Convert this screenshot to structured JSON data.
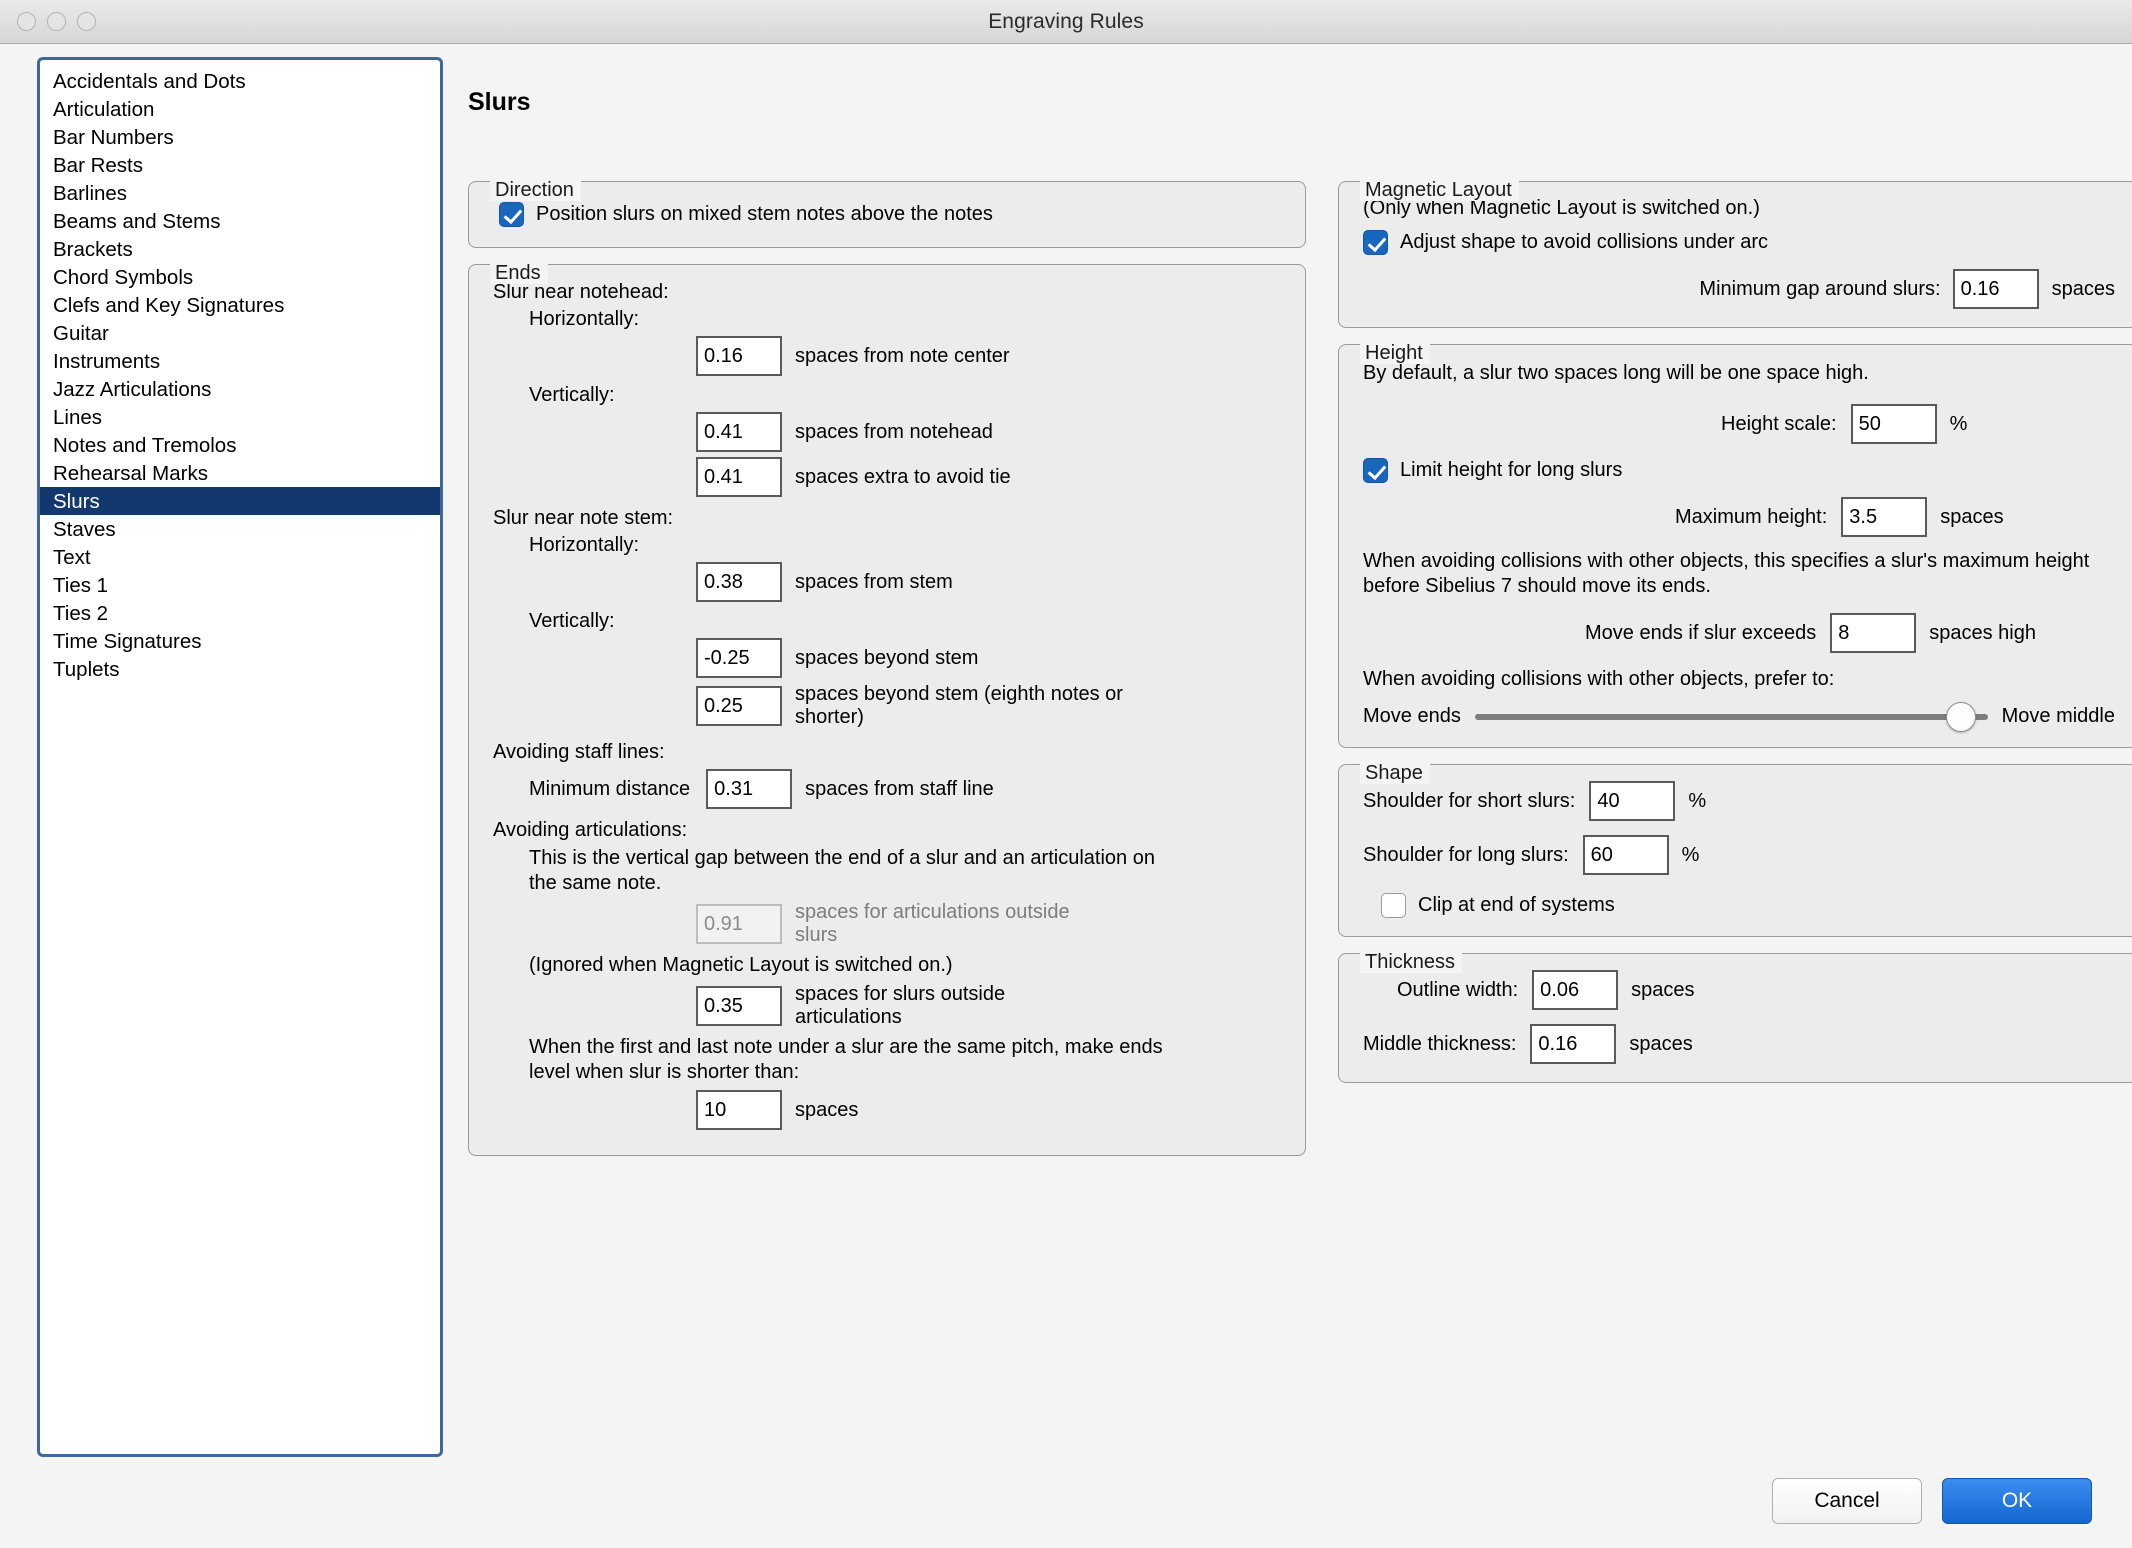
{
  "window": {
    "title": "Engraving Rules",
    "traffic_lights": [
      "close-button",
      "minimize-button",
      "zoom-button"
    ]
  },
  "sidebar": {
    "items": [
      {
        "label": "Accidentals and Dots",
        "selected": false
      },
      {
        "label": "Articulation",
        "selected": false
      },
      {
        "label": "Bar Numbers",
        "selected": false
      },
      {
        "label": "Bar Rests",
        "selected": false
      },
      {
        "label": "Barlines",
        "selected": false
      },
      {
        "label": "Beams and Stems",
        "selected": false
      },
      {
        "label": "Brackets",
        "selected": false
      },
      {
        "label": "Chord Symbols",
        "selected": false
      },
      {
        "label": "Clefs and Key Signatures",
        "selected": false
      },
      {
        "label": "Guitar",
        "selected": false
      },
      {
        "label": "Instruments",
        "selected": false
      },
      {
        "label": "Jazz Articulations",
        "selected": false
      },
      {
        "label": "Lines",
        "selected": false
      },
      {
        "label": "Notes and Tremolos",
        "selected": false
      },
      {
        "label": "Rehearsal Marks",
        "selected": false
      },
      {
        "label": "Slurs",
        "selected": true
      },
      {
        "label": "Staves",
        "selected": false
      },
      {
        "label": "Text",
        "selected": false
      },
      {
        "label": "Ties 1",
        "selected": false
      },
      {
        "label": "Ties 2",
        "selected": false
      },
      {
        "label": "Time Signatures",
        "selected": false
      },
      {
        "label": "Tuplets",
        "selected": false
      }
    ]
  },
  "page": {
    "title": "Slurs"
  },
  "direction": {
    "legend": "Direction",
    "checkbox_label": "Position slurs on mixed stem notes above the notes",
    "checked": true
  },
  "ends": {
    "legend": "Ends",
    "near_notehead_heading": "Slur near notehead:",
    "horizontally_label": "Horizontally:",
    "vertically_label": "Vertically:",
    "note_center": {
      "value": "0.16",
      "unit": "spaces from note center"
    },
    "from_notehead": {
      "value": "0.41",
      "unit": "spaces from notehead"
    },
    "extra_avoid_tie": {
      "value": "0.41",
      "unit": "spaces extra to avoid tie"
    },
    "near_stem_heading": "Slur near note stem:",
    "horizontally_label2": "Horizontally:",
    "from_stem": {
      "value": "0.38",
      "unit": "spaces from stem"
    },
    "vertically_label2": "Vertically:",
    "beyond_stem": {
      "value": "-0.25",
      "unit": "spaces beyond stem"
    },
    "beyond_stem_eighth": {
      "value": "0.25",
      "unit": "spaces beyond stem (eighth notes or shorter)"
    },
    "avoiding_staff_lines_heading": "Avoiding staff lines:",
    "minimum_distance_label": "Minimum distance",
    "minimum_distance": {
      "value": "0.31",
      "unit": "spaces from staff line"
    },
    "avoiding_articulations_heading": "Avoiding articulations:",
    "articulation_note": "This is the vertical gap between the end of a slur and an articulation on the same note.",
    "articulations_outside": {
      "value": "0.91",
      "unit": "spaces for articulations outside slurs",
      "disabled": true
    },
    "ignored_note": "(Ignored when Magnetic Layout is switched on.)",
    "slurs_outside": {
      "value": "0.35",
      "unit": "spaces for slurs outside articulations"
    },
    "same_pitch_note": "When the first and last note under a slur are the same pitch, make ends level when slur is shorter than:",
    "shorter_than": {
      "value": "10",
      "unit": "spaces"
    }
  },
  "magnetic_layout": {
    "legend": "Magnetic Layout",
    "note": "(Only when Magnetic Layout is switched on.)",
    "adjust_shape_label": "Adjust shape to avoid collisions under arc",
    "adjust_shape_checked": true,
    "minimum_gap_label": "Minimum gap around slurs:",
    "minimum_gap": {
      "value": "0.16",
      "unit": "spaces"
    }
  },
  "height": {
    "legend": "Height",
    "default_note": "By default, a slur two spaces long will be one space high.",
    "height_scale_label": "Height scale:",
    "height_scale": {
      "value": "50",
      "unit": "%"
    },
    "limit_height_label": "Limit height for long slurs",
    "limit_height_checked": true,
    "maximum_height_label": "Maximum height:",
    "maximum_height": {
      "value": "3.5",
      "unit": "spaces"
    },
    "collision_note": "When avoiding collisions with other objects, this specifies a slur's maximum height before Sibelius 7 should move its ends.",
    "move_ends_if_label": "Move ends if slur exceeds",
    "move_ends_if": {
      "value": "8",
      "unit": "spaces high"
    },
    "prefer_note": "When avoiding collisions with other objects, prefer to:",
    "slider_left_label": "Move ends",
    "slider_right_label": "Move middle",
    "slider_position_percent": 94
  },
  "shape": {
    "legend": "Shape",
    "shoulder_short_label": "Shoulder for short slurs:",
    "shoulder_short": {
      "value": "40",
      "unit": "%"
    },
    "shoulder_long_label": "Shoulder for long slurs:",
    "shoulder_long": {
      "value": "60",
      "unit": "%"
    },
    "clip_label": "Clip at end of systems",
    "clip_checked": false
  },
  "thickness": {
    "legend": "Thickness",
    "outline_width_label": "Outline width:",
    "outline_width": {
      "value": "0.06",
      "unit": "spaces"
    },
    "middle_thickness_label": "Middle thickness:",
    "middle_thickness": {
      "value": "0.16",
      "unit": "spaces"
    }
  },
  "footer": {
    "cancel_label": "Cancel",
    "ok_label": "OK"
  },
  "colors": {
    "accent": "#1866bd",
    "selection": "#12386e",
    "sidebar_border": "#3f6899",
    "primary_button": "#1466cf"
  }
}
